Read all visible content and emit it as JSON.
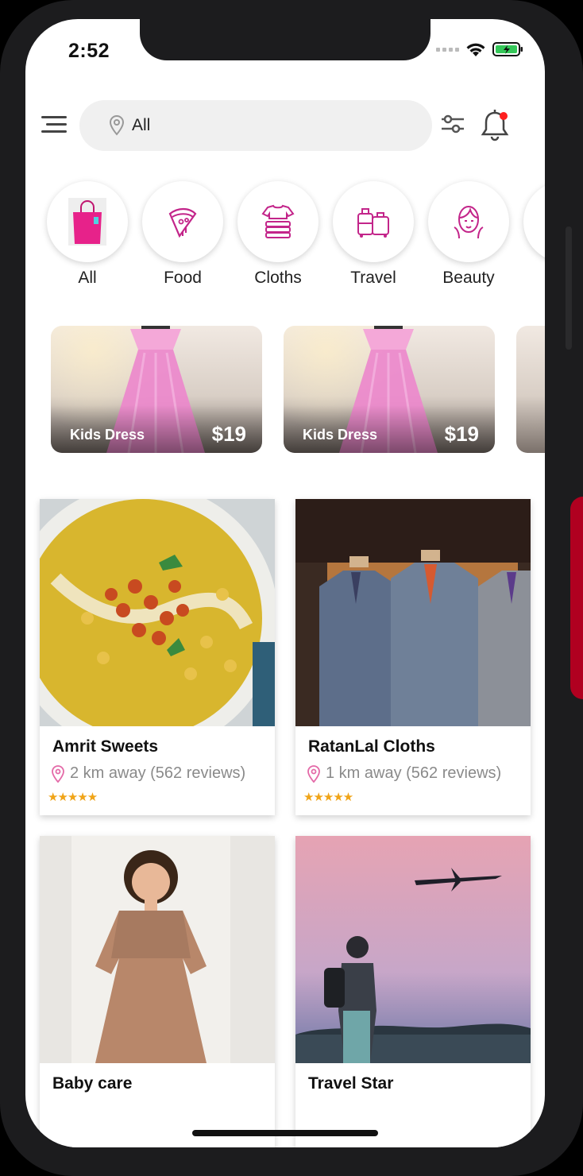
{
  "status": {
    "time": "2:52"
  },
  "search": {
    "value": "All"
  },
  "categories": [
    {
      "label": "All",
      "icon": "shopping-bag-icon"
    },
    {
      "label": "Food",
      "icon": "pizza-slice-icon"
    },
    {
      "label": "Cloths",
      "icon": "clothes-stack-icon"
    },
    {
      "label": "Travel",
      "icon": "luggage-icon"
    },
    {
      "label": "Beauty",
      "icon": "beauty-face-icon"
    }
  ],
  "banners": [
    {
      "title": "Kids Dress",
      "price": "$19"
    },
    {
      "title": "Kids Dress",
      "price": "$19"
    }
  ],
  "shops": [
    {
      "name": "Amrit Sweets",
      "meta": "2 km away (562 reviews)",
      "stars": "★★★★★"
    },
    {
      "name": "RatanLal Cloths",
      "meta": "1 km away (562 reviews)",
      "stars": "★★★★★"
    },
    {
      "name": "Baby care"
    },
    {
      "name": "Travel Star"
    }
  ],
  "colors": {
    "accent": "#e7228a",
    "star": "#f0a418",
    "notification_dot": "#ff2020"
  }
}
